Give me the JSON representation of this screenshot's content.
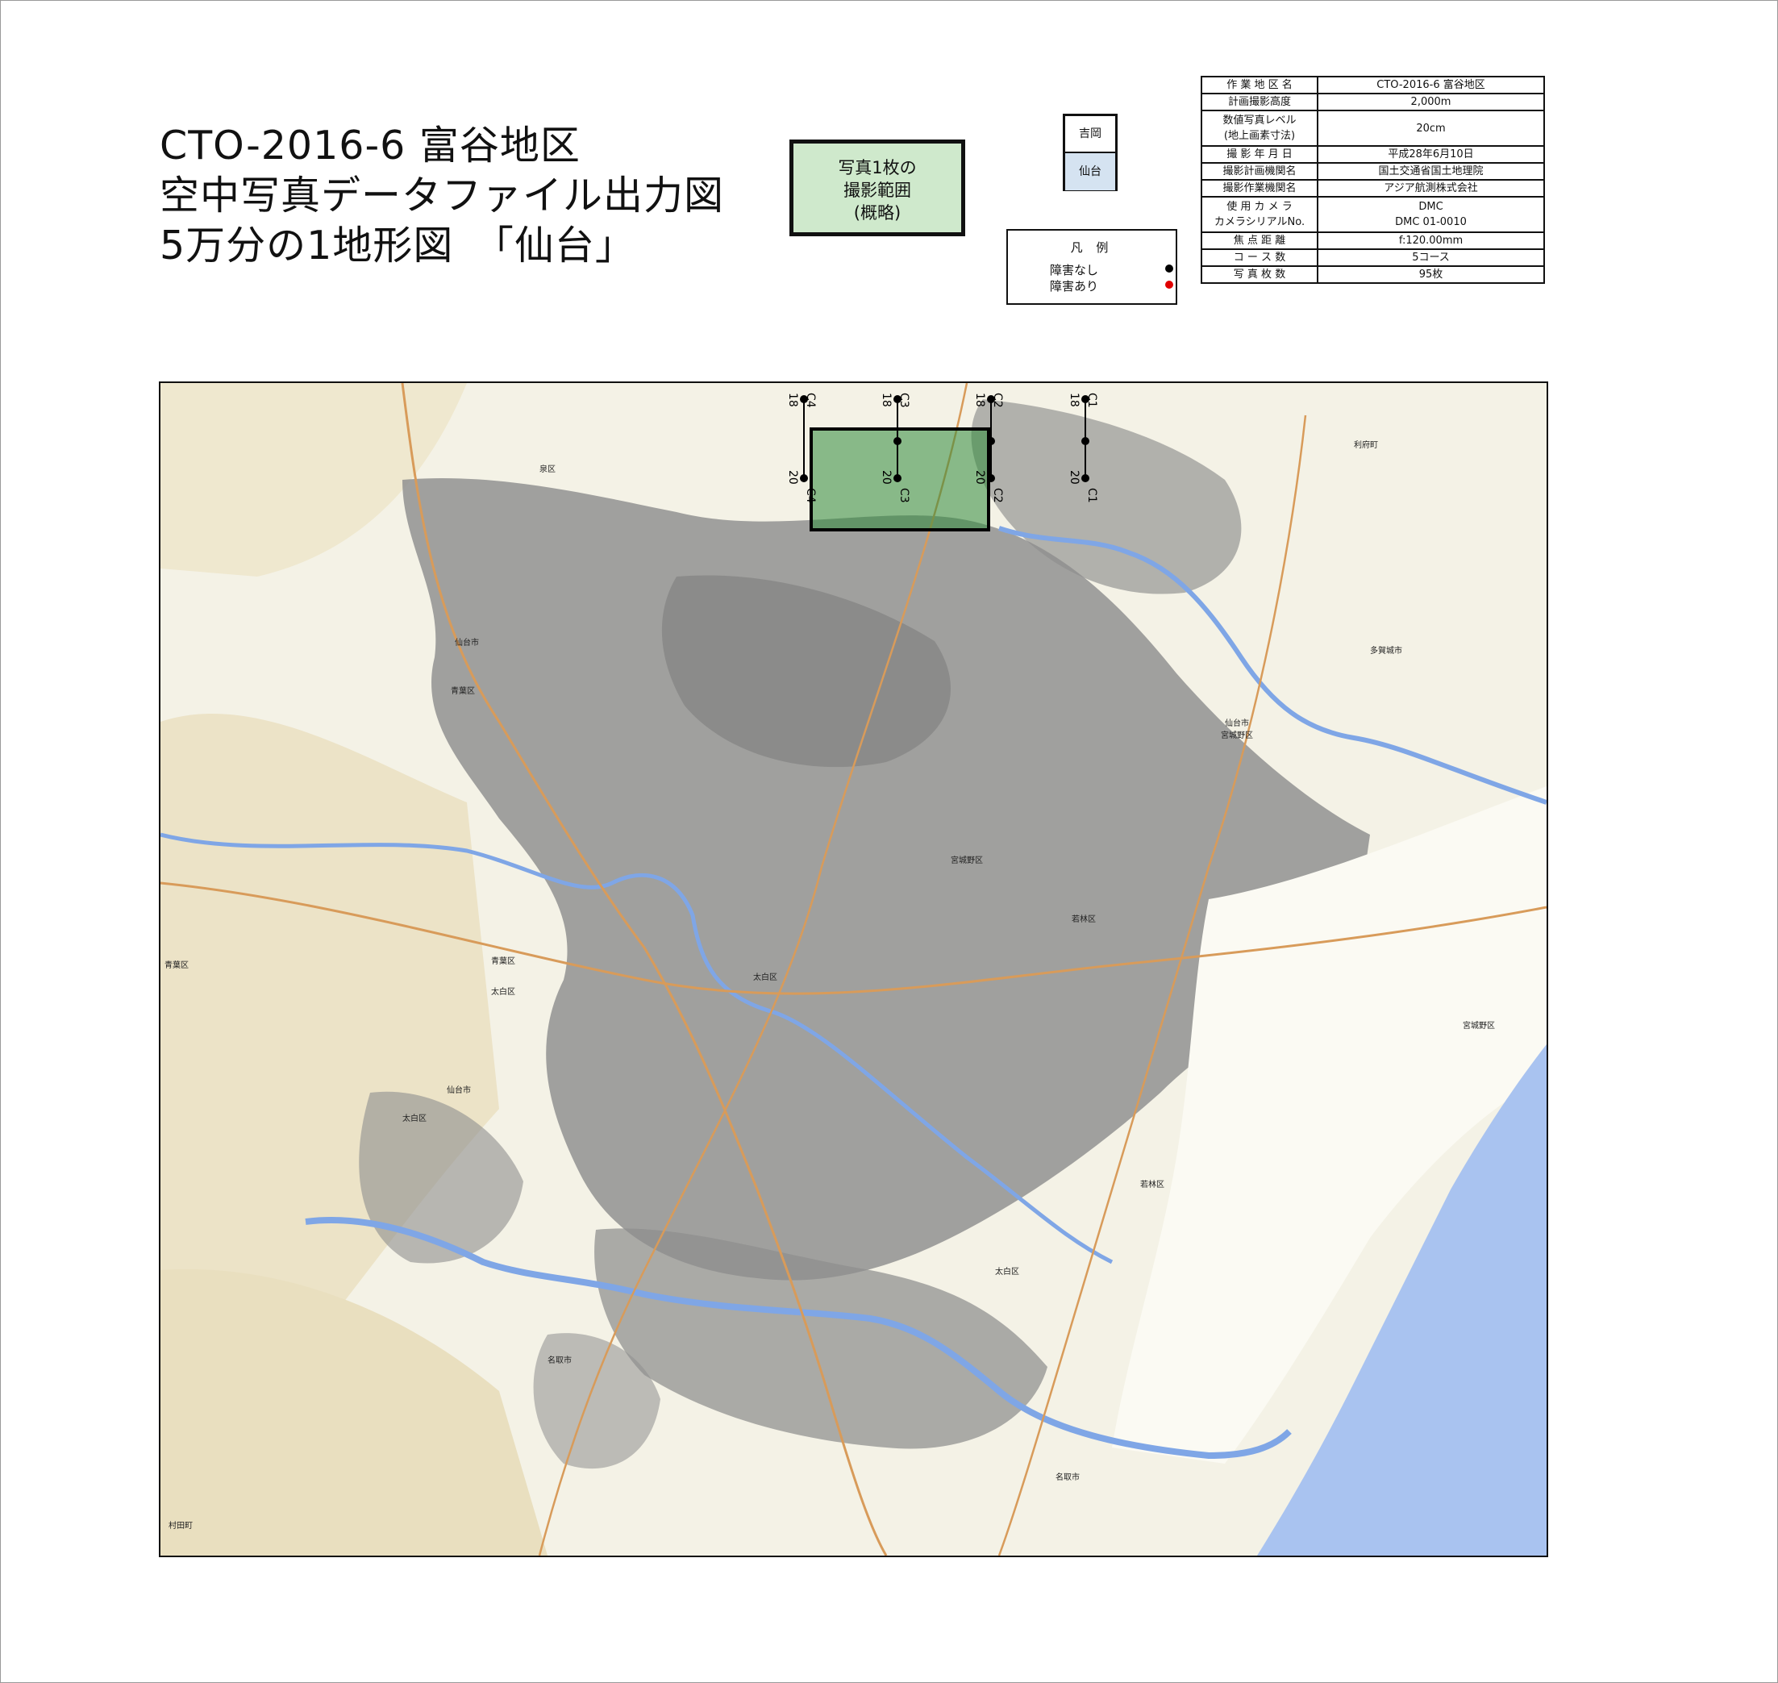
{
  "title": {
    "line1": "CTO-2016-6 富谷地区",
    "line2": "空中写真データファイル出力図",
    "line3": "5万分の1地形図　「仙台」"
  },
  "coverage_box": {
    "line1": "写真1枚の",
    "line2": "撮影範囲",
    "line3": "(概略)",
    "fill": "#cfe9cc"
  },
  "sheet_index": {
    "north": "吉岡",
    "current": "仙台",
    "current_fill": "#d5e3f1"
  },
  "legend": {
    "title": "凡 例",
    "items": [
      {
        "label": "障害なし",
        "color": "#000000"
      },
      {
        "label": "障害あり",
        "color": "#e00000"
      }
    ]
  },
  "info_table": [
    {
      "key": "作 業 地 区 名",
      "value": "CTO-2016-6 富谷地区"
    },
    {
      "key": "計画撮影高度",
      "value": "2,000m"
    },
    {
      "key": "数値写真レベル",
      "key2": "(地上画素寸法)",
      "value": "20cm"
    },
    {
      "key": "撮 影 年 月 日",
      "value": "平成28年6月10日"
    },
    {
      "key": "撮影計画機関名",
      "value": "国土交通省国土地理院"
    },
    {
      "key": "撮影作業機関名",
      "value": "アジア航測株式会社"
    },
    {
      "key": "使 用 カ メ ラ",
      "key2": "カメラシリアルNo.",
      "value": "DMC",
      "value2": "DMC 01-0010"
    },
    {
      "key": "焦 点 距 離",
      "value": "f:120.00mm"
    },
    {
      "key": "コ ー ス 数",
      "value": "5コース"
    },
    {
      "key": "写 真 枚 数",
      "value": "95枚"
    }
  ],
  "map": {
    "sea_color": "#a9c3f0",
    "urban_color": "#8e8e8e",
    "land_color": "#f4f2e6",
    "river_color": "#7fa6e6",
    "photo_fill": "#2f8a3a",
    "courses": [
      {
        "name": "C4",
        "start": "18",
        "end": "20"
      },
      {
        "name": "C3",
        "start": "18",
        "end": "20"
      },
      {
        "name": "C2",
        "start": "18",
        "end": "20"
      },
      {
        "name": "C1",
        "start": "18",
        "end": "20"
      }
    ],
    "place_labels": [
      "泉区",
      "仙台市",
      "青葉区",
      "宮城野区",
      "多賀城市",
      "仙台市",
      "宮城野区",
      "若林区",
      "太白区",
      "青葉区",
      "太白区",
      "仙台市",
      "太白区",
      "名取市",
      "宮城野区",
      "若林区",
      "名取市",
      "太白区",
      "青葉区",
      "利府町",
      "村田町"
    ]
  }
}
